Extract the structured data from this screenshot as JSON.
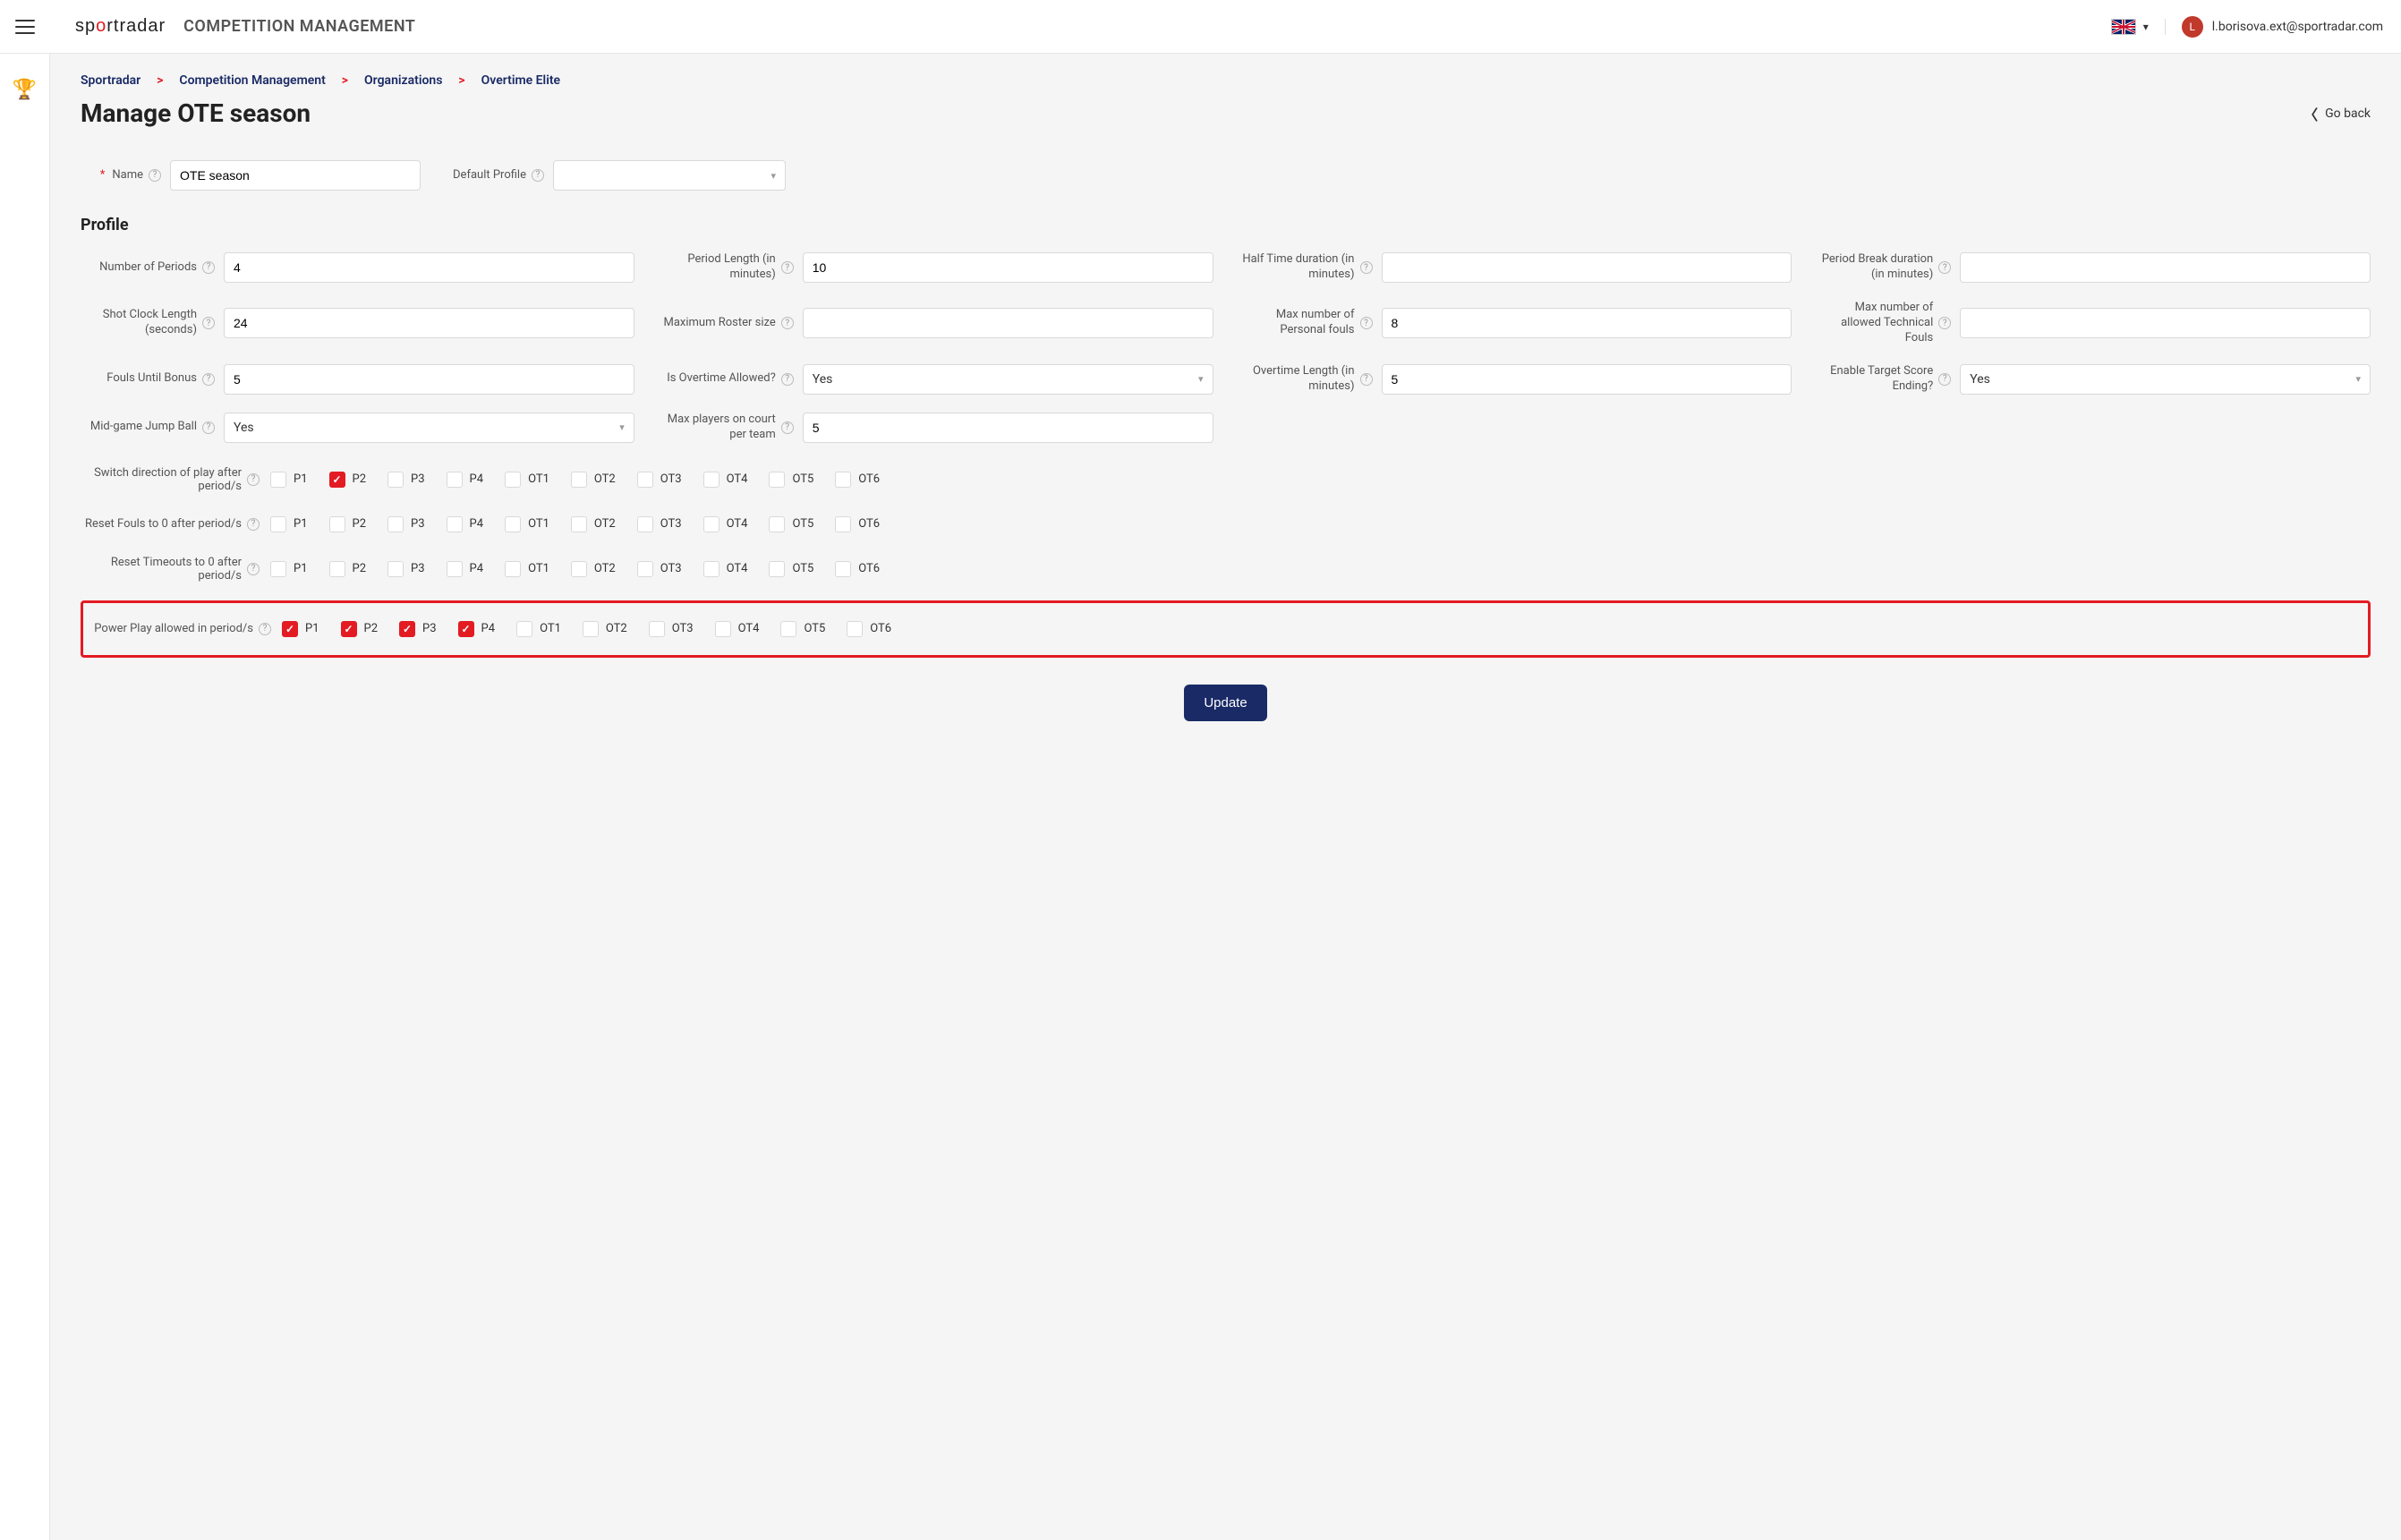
{
  "topbar": {
    "app_title": "COMPETITION MANAGEMENT",
    "user": "l.borisova.ext@sportradar.com",
    "avatar_letter": "L"
  },
  "breadcrumbs": [
    "Sportradar",
    "Competition Management",
    "Organizations",
    "Overtime Elite"
  ],
  "page": {
    "title": "Manage OTE season",
    "go_back": "Go back"
  },
  "form": {
    "name": {
      "label": "Name",
      "value": "OTE season",
      "required": true
    },
    "default_profile": {
      "label": "Default Profile",
      "value": ""
    }
  },
  "profile_section_title": "Profile",
  "profile": {
    "number_of_periods": {
      "label": "Number of Periods",
      "value": "4"
    },
    "period_length": {
      "label": "Period Length (in minutes)",
      "value": "10"
    },
    "half_time": {
      "label": "Half Time duration (in minutes)",
      "value": ""
    },
    "period_break": {
      "label": "Period Break duration (in minutes)",
      "value": ""
    },
    "shot_clock": {
      "label": "Shot Clock Length (seconds)",
      "value": "24"
    },
    "max_roster": {
      "label": "Maximum Roster size",
      "value": ""
    },
    "max_personal_fouls": {
      "label": "Max number of Personal fouls",
      "value": "8"
    },
    "max_tech_fouls": {
      "label": "Max number of allowed Technical Fouls",
      "value": ""
    },
    "fouls_until_bonus": {
      "label": "Fouls Until Bonus",
      "value": "5"
    },
    "overtime_allowed": {
      "label": "Is Overtime Allowed?",
      "value": "Yes"
    },
    "overtime_length": {
      "label": "Overtime Length (in minutes)",
      "value": "5"
    },
    "target_score": {
      "label": "Enable Target Score Ending?",
      "value": "Yes"
    },
    "midgame_jump": {
      "label": "Mid-game Jump Ball",
      "value": "Yes"
    },
    "max_players": {
      "label": "Max players on court per team",
      "value": "5"
    }
  },
  "period_labels": [
    "P1",
    "P2",
    "P3",
    "P4",
    "OT1",
    "OT2",
    "OT3",
    "OT4",
    "OT5",
    "OT6"
  ],
  "check_groups": [
    {
      "label": "Switch direction of play after period/s",
      "checked": [
        "P2"
      ],
      "highlight": false
    },
    {
      "label": "Reset Fouls to 0 after period/s",
      "checked": [],
      "highlight": false
    },
    {
      "label": "Reset Timeouts to 0 after period/s",
      "checked": [],
      "highlight": false
    },
    {
      "label": "Power Play allowed in period/s",
      "checked": [
        "P1",
        "P2",
        "P3",
        "P4"
      ],
      "highlight": true
    }
  ],
  "update_button": "Update"
}
